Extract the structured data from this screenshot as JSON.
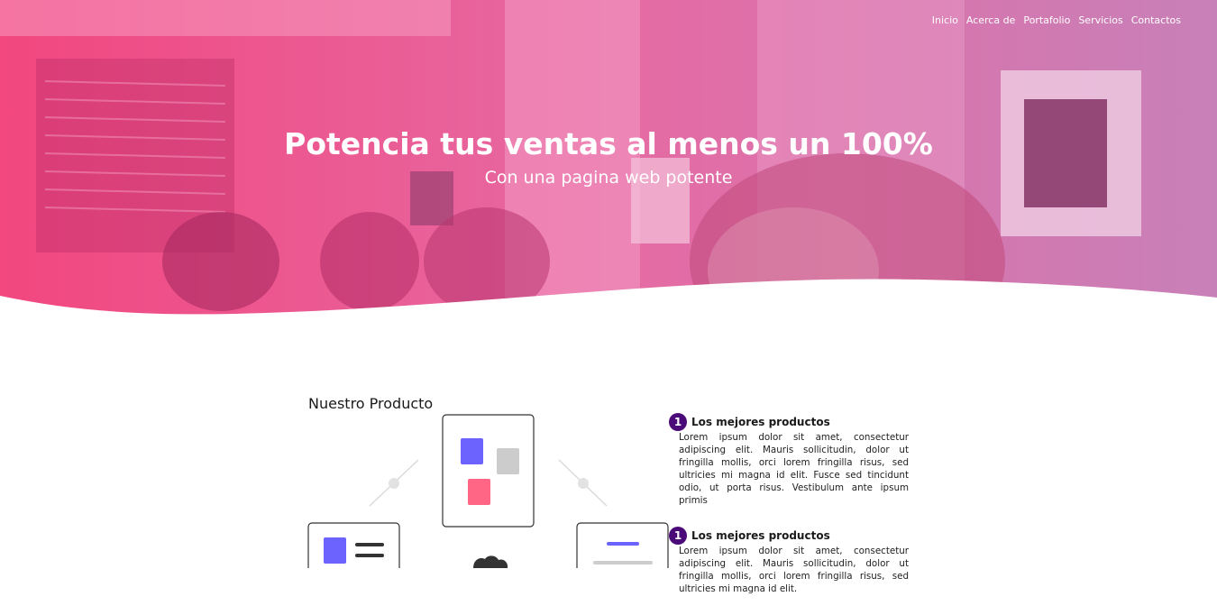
{
  "nav": {
    "items": [
      "Inicio",
      "Acerca de",
      "Portafolio",
      "Servicios",
      "Contactos"
    ]
  },
  "hero": {
    "title": "Potencia tus ventas al menos un 100%",
    "subtitle": "Con una pagina web potente",
    "overlay_colors": [
      "#f0407a",
      "#c24f9a"
    ]
  },
  "product": {
    "title": "Nuestro Producto",
    "features": [
      {
        "number": "1",
        "title": "Los mejores productos",
        "text": "Lorem ipsum dolor sit amet, consectetur adipiscing elit. Mauris sollicitudin, dolor ut fringilla mollis, orci lorem fringilla risus, sed ultricies mi magna id elit. Fusce sed tincidunt odio, ut porta risus. Vestibulum ante ipsum primis"
      },
      {
        "number": "1",
        "title": "Los mejores productos",
        "text": "Lorem ipsum dolor sit amet, consectetur adipiscing elit. Mauris sollicitudin, dolor ut fringilla mollis, orci lorem fringilla risus, sed ultricies mi magna id elit."
      }
    ]
  },
  "colors": {
    "accent": "#4a0a78",
    "square_blue": "#6c63ff",
    "square_pink": "#ff6584",
    "square_gray": "#cccccc"
  }
}
